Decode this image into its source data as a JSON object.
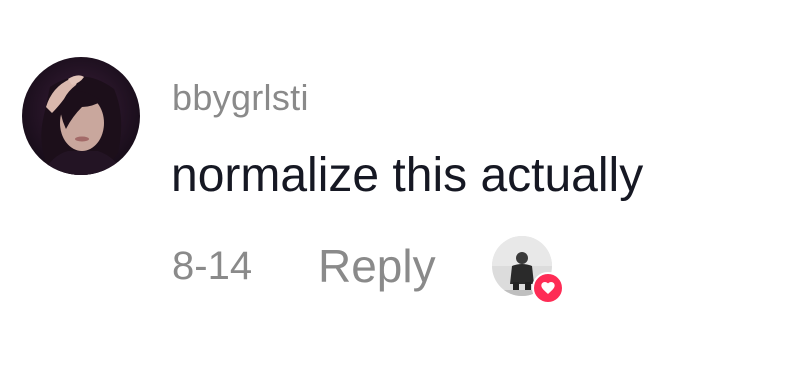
{
  "comment": {
    "username": "bbygrlsti",
    "text": "normalize this actually",
    "date": "8-14",
    "reply_label": "Reply"
  },
  "icons": {
    "commenter_avatar": "user-avatar-photo",
    "liker_avatar": "creator-avatar-photo",
    "liked_badge": "heart-icon"
  },
  "colors": {
    "muted_text": "#8a8a8a",
    "primary_text": "#161823",
    "heart_badge": "#fe2c55"
  }
}
